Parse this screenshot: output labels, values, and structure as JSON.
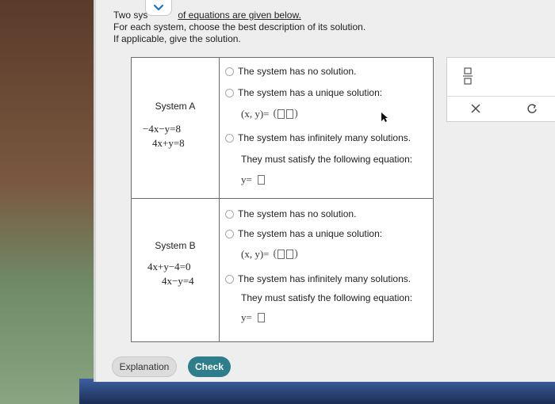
{
  "prompt": {
    "line1_pre": "Two sys",
    "line1_post": "of equations are given below.",
    "line2": "For each system, choose the best description of its solution.",
    "line3": "If applicable, give the solution."
  },
  "systems": [
    {
      "title": "System A",
      "eq1": "−4x−y=8",
      "eq2": "4x+y=8",
      "opt_none": "The system has no solution.",
      "opt_unique": "The system has a unique solution:",
      "xy_label": "(x, y)=",
      "opt_inf": "The system has infinitely many solutions.",
      "inf_sub": "They must satisfy the following equation:",
      "y_label": "y="
    },
    {
      "title": "System B",
      "eq1": "4x+y−4=0",
      "eq2": "4x−y=4",
      "opt_none": "The system has no solution.",
      "opt_unique": "The system has a unique solution:",
      "xy_label": "(x, y)=",
      "opt_inf": "The system has infinitely many solutions.",
      "inf_sub": "They must satisfy the following equation:",
      "y_label": "y="
    }
  ],
  "buttons": {
    "explanation": "Explanation",
    "check": "Check"
  },
  "icons": {
    "fraction": "fraction-icon",
    "clear": "x-icon",
    "undo": "undo-icon",
    "chevron": "chevron-down-icon"
  },
  "colors": {
    "check_button": "#2d7d8a",
    "accent_chevron": "#1a73c9"
  }
}
